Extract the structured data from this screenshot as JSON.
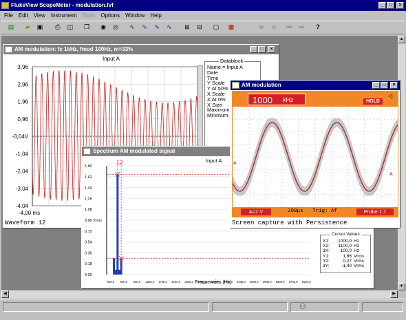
{
  "app": {
    "title": "FlukeView ScopeMeter - modulation.fvf"
  },
  "menu": [
    "File",
    "Edit",
    "View",
    "Instrument",
    "Tools",
    "Options",
    "Window",
    "Help"
  ],
  "wave_window": {
    "title": "AM modulation: fc 1kHz, fmod 100Hz, m=33%",
    "channel": "Input A",
    "y_ticks": [
      "3,96",
      "2,96",
      "1,96",
      "0,96",
      "-0,04V",
      "-1,04",
      "-2,04",
      "-3,04",
      "-4,04"
    ],
    "x_start": "-4,00 ms",
    "status": "Waveform 12",
    "datablock": {
      "title": "Datablock",
      "rows": [
        "Name = Input A",
        "Date",
        "Time",
        "Y Scale",
        "Y At 50%",
        "X Scale",
        "X At 0%",
        "X Size",
        "Maximum",
        "Minimum"
      ]
    }
  },
  "spectrum_window": {
    "title": "Spectrum  AM modulated signal",
    "channel": "Input A",
    "cursor_label": "12",
    "y_ticks": [
      "1,80",
      "1,62",
      "1,44",
      "1,26",
      "1,08",
      "0,90 Vrms",
      "0,72",
      "0,54",
      "0,36",
      "0,18",
      "0,00"
    ],
    "x_ticks": [
      "900,0",
      "500,0",
      "900,0",
      "1300,0",
      "1700,0",
      "2100,0",
      "2500,0",
      "2900,0",
      "3300,0",
      "3700,0",
      "4100,0",
      "4500,0",
      "4900,0",
      "5300,0",
      "5700,0",
      "6100,0"
    ],
    "xlabel": "Frequencies (Hz)",
    "cursor_values": {
      "title": "Cursor Values",
      "rows": [
        [
          "X1:",
          "1000,0",
          "Hz"
        ],
        [
          "X2:",
          "1100,0",
          "Hz"
        ],
        [
          "dX:",
          "100,0",
          "Hz"
        ],
        [
          "Y1:",
          "1,66",
          "Vrms"
        ],
        [
          "Y2:",
          "0,27",
          "Vrms"
        ],
        [
          "dY:",
          "-1,40",
          "Vrms"
        ]
      ]
    }
  },
  "scope_window": {
    "title": "AM modulation",
    "readout": "1000",
    "readout_unit": "kHz",
    "hold": "HOLD",
    "footer": {
      "range": "A=1 V",
      "time": "200μs",
      "trig": "Trig: Af",
      "probe": "Probe 1:1"
    },
    "caption": "Screen capture with Persistence"
  },
  "colors": {
    "titlebar": "#000080",
    "wave": "#cc2020",
    "bar": "#1c3cb0",
    "orange": "#f08828"
  },
  "chart_data": [
    {
      "type": "line",
      "title": "AM modulation: fc 1kHz, fmod 100Hz, m=33%",
      "ylim": [
        -4.04,
        3.96
      ],
      "series": [
        {
          "name": "Input A",
          "carrier_hz": 1000,
          "mod_hz": 100,
          "depth": 0.33,
          "amplitude": 3.0
        }
      ]
    },
    {
      "type": "bar",
      "title": "Spectrum  AM modulated signal",
      "xlabel": "Frequencies (Hz)",
      "ylabel": "Vrms",
      "ylim": [
        0,
        1.8
      ],
      "x": [
        900,
        1000,
        1100
      ],
      "values": [
        0.27,
        1.66,
        0.27
      ]
    }
  ]
}
